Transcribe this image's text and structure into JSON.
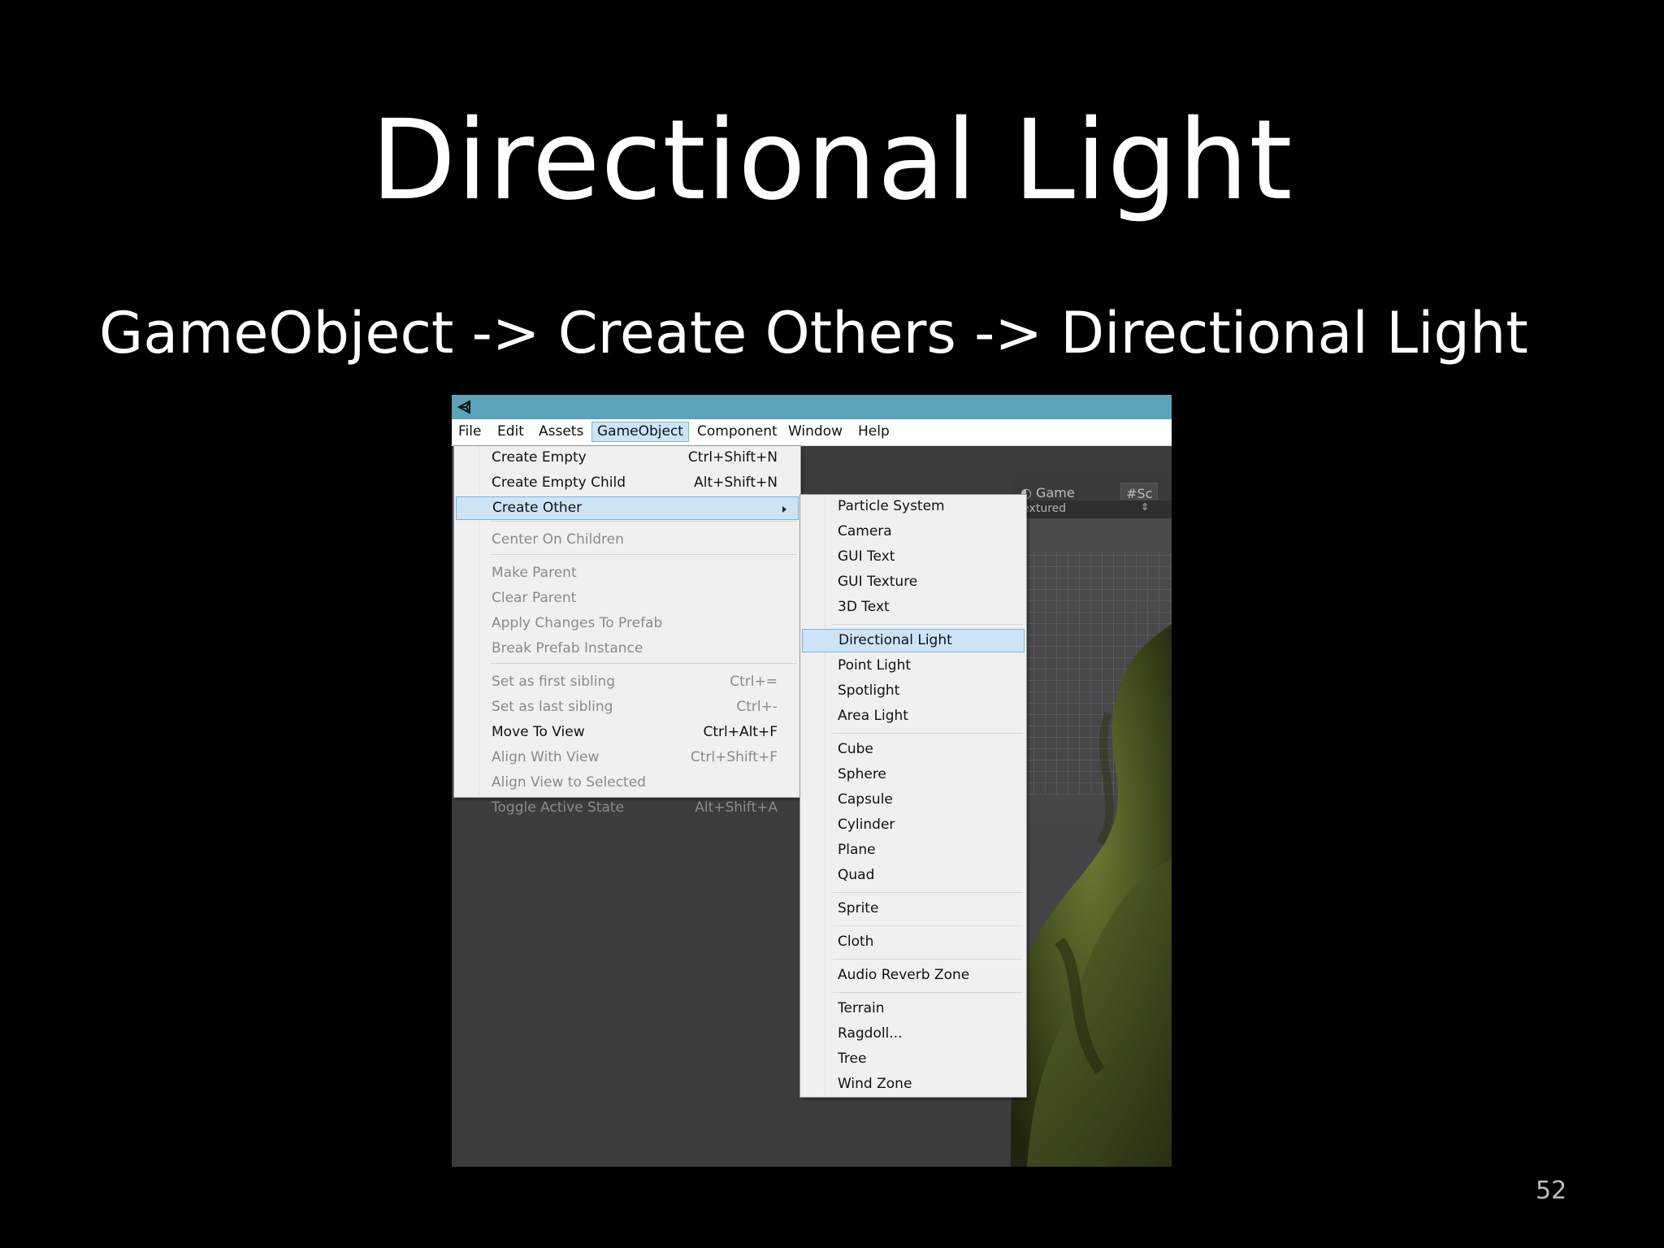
{
  "slide": {
    "title": "Directional Light",
    "subtitle": "GameObject -> Create Others -> Directional Light",
    "page_number": "52"
  },
  "menubar": {
    "items": [
      "File",
      "Edit",
      "Assets",
      "GameObject",
      "Component",
      "Window",
      "Help"
    ],
    "active": "GameObject"
  },
  "gameobject_menu": {
    "items": [
      {
        "label": "Create Empty",
        "shortcut": "Ctrl+Shift+N",
        "enabled": true
      },
      {
        "label": "Create Empty Child",
        "shortcut": "Alt+Shift+N",
        "enabled": true
      },
      {
        "label": "Create Other",
        "shortcut": "",
        "enabled": true,
        "submenu": true,
        "highlighted": true
      },
      {
        "label": "Center On Children",
        "shortcut": "",
        "enabled": false
      },
      {
        "label": "Make Parent",
        "shortcut": "",
        "enabled": false
      },
      {
        "label": "Clear Parent",
        "shortcut": "",
        "enabled": false
      },
      {
        "label": "Apply Changes To Prefab",
        "shortcut": "",
        "enabled": false
      },
      {
        "label": "Break Prefab Instance",
        "shortcut": "",
        "enabled": false
      },
      {
        "label": "Set as first sibling",
        "shortcut": "Ctrl+=",
        "enabled": false
      },
      {
        "label": "Set as last sibling",
        "shortcut": "Ctrl+-",
        "enabled": false
      },
      {
        "label": "Move To View",
        "shortcut": "Ctrl+Alt+F",
        "enabled": true
      },
      {
        "label": "Align With View",
        "shortcut": "Ctrl+Shift+F",
        "enabled": false
      },
      {
        "label": "Align View to Selected",
        "shortcut": "",
        "enabled": false
      },
      {
        "label": "Toggle Active State",
        "shortcut": "Alt+Shift+A",
        "enabled": false
      }
    ]
  },
  "create_other_menu": {
    "items": [
      "Particle System",
      "Camera",
      "GUI Text",
      "GUI Texture",
      "3D Text",
      "Directional Light",
      "Point Light",
      "Spotlight",
      "Area Light",
      "Cube",
      "Sphere",
      "Capsule",
      "Cylinder",
      "Plane",
      "Quad",
      "Sprite",
      "Cloth",
      "Audio Reverb Zone",
      "Terrain",
      "Ragdoll...",
      "Tree",
      "Wind Zone"
    ],
    "highlighted": "Directional Light"
  },
  "game_view": {
    "tab_game": "Game",
    "tab_scene": "Sc",
    "display_mode": "Textured"
  },
  "colors": {
    "titlebar": "#5aa3b8",
    "highlight": "#cde4f7",
    "highlight_border": "#7fb2de"
  }
}
